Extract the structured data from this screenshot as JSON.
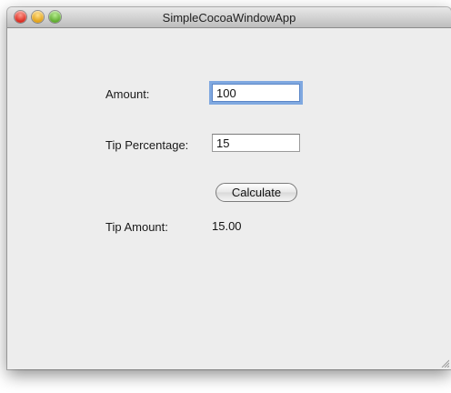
{
  "window": {
    "title": "SimpleCocoaWindowApp"
  },
  "form": {
    "amount_label": "Amount:",
    "amount_value": "100",
    "tip_percentage_label": "Tip Percentage:",
    "tip_percentage_value": "15",
    "calculate_label": "Calculate",
    "tip_amount_label": "Tip Amount:",
    "tip_amount_value": "15.00"
  },
  "icons": {
    "close": "close-icon",
    "minimize": "minimize-icon",
    "zoom": "zoom-icon",
    "resize": "resize-grip-icon"
  },
  "colors": {
    "window_bg": "#ededed",
    "focus_ring": "#7fa8e0",
    "close": "#d8261b",
    "minimize": "#e09e12",
    "zoom": "#5ba82b"
  }
}
